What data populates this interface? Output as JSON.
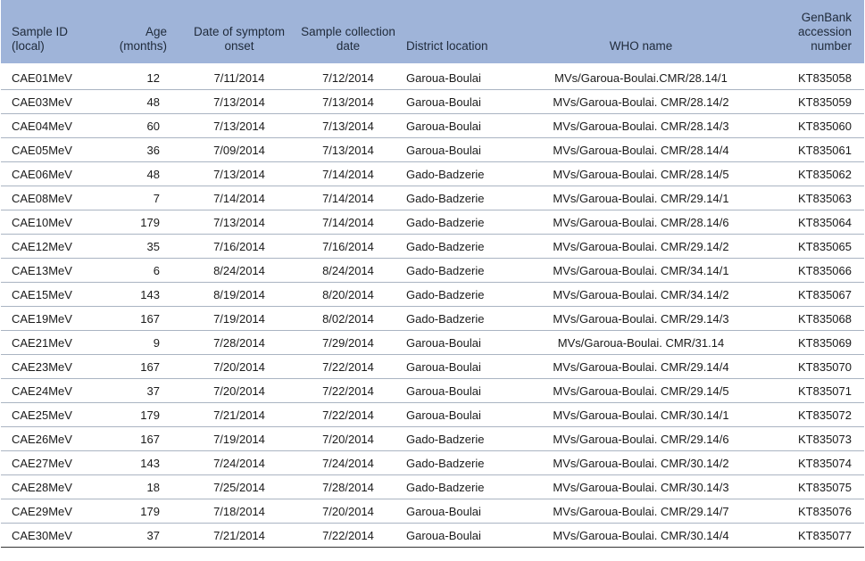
{
  "columns": [
    "Sample ID (local)",
    "Age (months)",
    "Date of symptom onset",
    "Sample collection date",
    "District location",
    "WHO name",
    "GenBank accession number"
  ],
  "rows": [
    [
      "CAE01MeV",
      "12",
      "7/11/2014",
      "7/12/2014",
      "Garoua-Boulai",
      "MVs/Garoua-Boulai.CMR/28.14/1",
      "KT835058"
    ],
    [
      "CAE03MeV",
      "48",
      "7/13/2014",
      "7/13/2014",
      "Garoua-Boulai",
      "MVs/Garoua-Boulai. CMR/28.14/2",
      "KT835059"
    ],
    [
      "CAE04MeV",
      "60",
      "7/13/2014",
      "7/13/2014",
      "Garoua-Boulai",
      "MVs/Garoua-Boulai. CMR/28.14/3",
      "KT835060"
    ],
    [
      "CAE05MeV",
      "36",
      "7/09/2014",
      "7/13/2014",
      "Garoua-Boulai",
      "MVs/Garoua-Boulai. CMR/28.14/4",
      "KT835061"
    ],
    [
      "CAE06MeV",
      "48",
      "7/13/2014",
      "7/14/2014",
      "Gado-Badzerie",
      "MVs/Garoua-Boulai. CMR/28.14/5",
      "KT835062"
    ],
    [
      "CAE08MeV",
      "7",
      "7/14/2014",
      "7/14/2014",
      "Gado-Badzerie",
      "MVs/Garoua-Boulai. CMR/29.14/1",
      "KT835063"
    ],
    [
      "CAE10MeV",
      "179",
      "7/13/2014",
      "7/14/2014",
      "Gado-Badzerie",
      "MVs/Garoua-Boulai. CMR/28.14/6",
      "KT835064"
    ],
    [
      "CAE12MeV",
      "35",
      "7/16/2014",
      "7/16/2014",
      "Gado-Badzerie",
      "MVs/Garoua-Boulai. CMR/29.14/2",
      "KT835065"
    ],
    [
      "CAE13MeV",
      "6",
      "8/24/2014",
      "8/24/2014",
      "Gado-Badzerie",
      "MVs/Garoua-Boulai. CMR/34.14/1",
      "KT835066"
    ],
    [
      "CAE15MeV",
      "143",
      "8/19/2014",
      "8/20/2014",
      "Gado-Badzerie",
      "MVs/Garoua-Boulai. CMR/34.14/2",
      "KT835067"
    ],
    [
      "CAE19MeV",
      "167",
      "7/19/2014",
      "8/02/2014",
      "Gado-Badzerie",
      "MVs/Garoua-Boulai. CMR/29.14/3",
      "KT835068"
    ],
    [
      "CAE21MeV",
      "9",
      "7/28/2014",
      "7/29/2014",
      "Garoua-Boulai",
      "MVs/Garoua-Boulai. CMR/31.14",
      "KT835069"
    ],
    [
      "CAE23MeV",
      "167",
      "7/20/2014",
      "7/22/2014",
      "Garoua-Boulai",
      "MVs/Garoua-Boulai. CMR/29.14/4",
      "KT835070"
    ],
    [
      "CAE24MeV",
      "37",
      "7/20/2014",
      "7/22/2014",
      "Garoua-Boulai",
      "MVs/Garoua-Boulai. CMR/29.14/5",
      "KT835071"
    ],
    [
      "CAE25MeV",
      "179",
      "7/21/2014",
      "7/22/2014",
      "Garoua-Boulai",
      "MVs/Garoua-Boulai. CMR/30.14/1",
      "KT835072"
    ],
    [
      "CAE26MeV",
      "167",
      "7/19/2014",
      "7/20/2014",
      "Gado-Badzerie",
      "MVs/Garoua-Boulai. CMR/29.14/6",
      "KT835073"
    ],
    [
      "CAE27MeV",
      "143",
      "7/24/2014",
      "7/24/2014",
      "Gado-Badzerie",
      "MVs/Garoua-Boulai. CMR/30.14/2",
      "KT835074"
    ],
    [
      "CAE28MeV",
      "18",
      "7/25/2014",
      "7/28/2014",
      "Gado-Badzerie",
      "MVs/Garoua-Boulai. CMR/30.14/3",
      "KT835075"
    ],
    [
      "CAE29MeV",
      "179",
      "7/18/2014",
      "7/20/2014",
      "Garoua-Boulai",
      "MVs/Garoua-Boulai. CMR/29.14/7",
      "KT835076"
    ],
    [
      "CAE30MeV",
      "37",
      "7/21/2014",
      "7/22/2014",
      "Garoua-Boulai",
      "MVs/Garoua-Boulai. CMR/30.14/4",
      "KT835077"
    ]
  ],
  "colors": {
    "header_bg": "#9fb4d9",
    "row_rule": "#aab4c2"
  }
}
